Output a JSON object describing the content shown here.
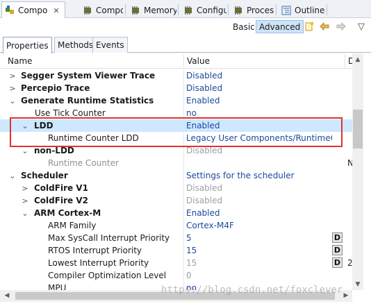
{
  "view_tabs": [
    {
      "label": "Compo",
      "icon": "component-icon",
      "active": true
    },
    {
      "label": "Compo",
      "icon": "chip-icon"
    },
    {
      "label": "Memory",
      "icon": "chip-icon"
    },
    {
      "label": "Configu",
      "icon": "chip-icon"
    },
    {
      "label": "Process",
      "icon": "chip-icon"
    },
    {
      "label": "Outline",
      "icon": "outline-icon"
    }
  ],
  "toolbar": {
    "basic_label": "Basic",
    "advanced_label": "Advanced",
    "icons": [
      "new-icon",
      "back-arrow-icon",
      "forward-arrow-icon",
      "view-menu-icon"
    ]
  },
  "inner_tabs": [
    "Properties",
    "Methods",
    "Events"
  ],
  "columns": {
    "name": "Name",
    "value": "Value",
    "extra": "D"
  },
  "rows": [
    {
      "name": "Segger System Viewer Trace",
      "value": "Disabled",
      "bold": true,
      "expander": "collapsed"
    },
    {
      "name": "Percepio Trace",
      "value": "Disabled",
      "bold": true,
      "expander": "collapsed"
    },
    {
      "name": "Generate Runtime Statistics",
      "value": "Enabled",
      "bold": true,
      "expander": "expanded"
    },
    {
      "name": "Use Tick Counter",
      "value": "no"
    },
    {
      "name": "LDD",
      "value": "Enabled",
      "bold": true,
      "expander": "expanded",
      "selected": true
    },
    {
      "name": "Runtime Counter LDD",
      "value": "Legacy User Components/RuntimeCntrL..."
    },
    {
      "name": "non-LDD",
      "value": "Disabled",
      "bold": true,
      "expander": "expanded",
      "gray_value": true
    },
    {
      "name": "Runtime Counter",
      "value": "",
      "gray_name": true,
      "extra": "N"
    },
    {
      "name": "Scheduler",
      "value": "Settings for the scheduler",
      "bold": true,
      "expander": "expanded"
    },
    {
      "name": "ColdFire V1",
      "value": "Disabled",
      "bold": true,
      "expander": "collapsed",
      "gray_value": true
    },
    {
      "name": "ColdFire V2",
      "value": "Disabled",
      "bold": true,
      "expander": "collapsed",
      "gray_value": true
    },
    {
      "name": "ARM Cortex-M",
      "value": "Enabled",
      "bold": true,
      "expander": "expanded"
    },
    {
      "name": "ARM Family",
      "value": "Cortex-M4F"
    },
    {
      "name": "Max SysCall Interrupt Priority",
      "value": "5",
      "dbutton": "D"
    },
    {
      "name": "RTOS Interrupt Priority",
      "value": "15",
      "dbutton": "D"
    },
    {
      "name": "Lowest Interrupt Priority",
      "value": "15",
      "dbutton": "D",
      "gray_value": true,
      "extra": "2"
    },
    {
      "name": "Compiler Optimization Level",
      "value": "0",
      "gray_value": true
    },
    {
      "name": "MPU",
      "value": "no"
    }
  ],
  "watermark": "https://blog.csdn.net/foxclever"
}
